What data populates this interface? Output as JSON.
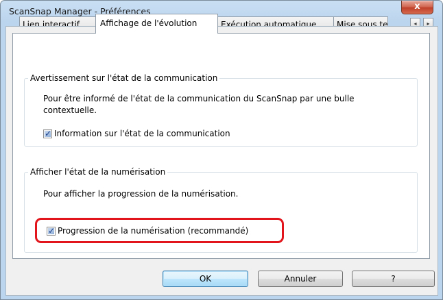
{
  "window": {
    "title": "ScanSnap Manager - Préférences",
    "close_glyph": "x"
  },
  "tabs": [
    {
      "label": "Lien interactif",
      "active": false
    },
    {
      "label": "Affichage de l'évolution",
      "active": true
    },
    {
      "label": "Exécution automatique",
      "active": false
    },
    {
      "label": "Mise sous tension",
      "active": false
    }
  ],
  "tab_scroll": {
    "left_glyph": "◂",
    "right_glyph": "▸"
  },
  "group_communication": {
    "title": "Avertissement sur l'état de la communication",
    "description_line1": "Pour être informé de l'état de la communication du ScanSnap par une bulle",
    "description_line2": "contextuelle.",
    "checkbox_label": "Information sur l'état de la communication",
    "checked": true
  },
  "group_progress": {
    "title": "Afficher l'état de la numérisation",
    "description": "Pour afficher la progression de la numérisation.",
    "checkbox_label": "Progression de la numérisation (recommandé)",
    "checked": true
  },
  "check_glyph": "✓",
  "buttons": {
    "ok": "OK",
    "cancel": "Annuler",
    "help": "?"
  },
  "colors": {
    "highlight": "#e2141c",
    "title_bar": "#bcd5ee",
    "close_button": "#c0412a"
  }
}
